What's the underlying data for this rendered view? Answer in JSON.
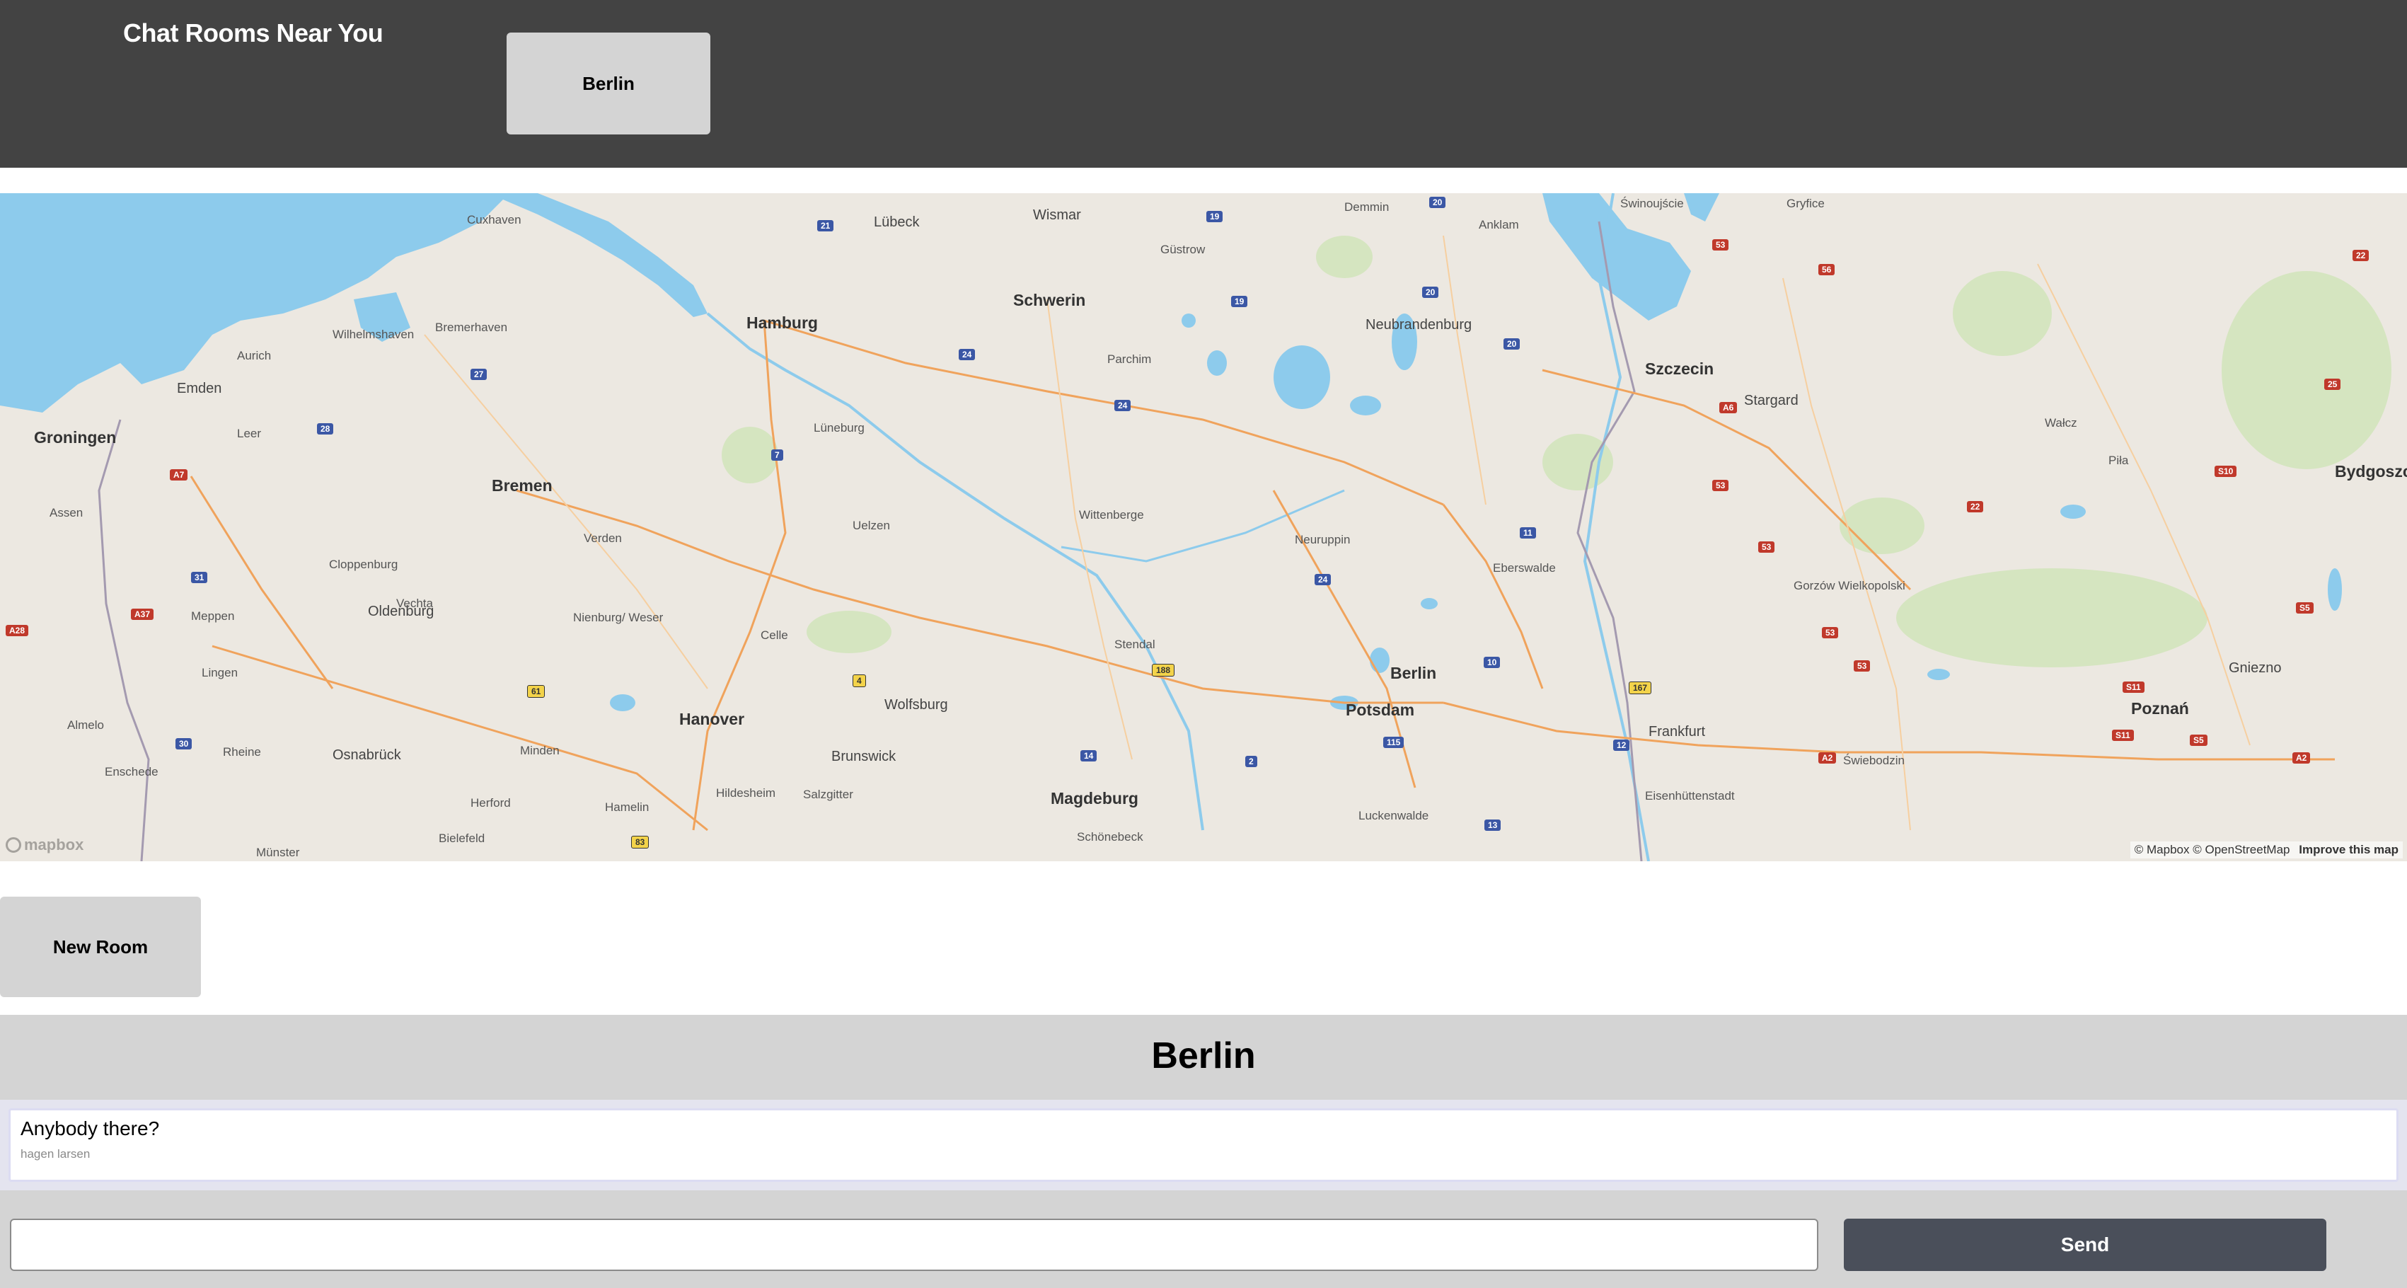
{
  "header": {
    "title": "Chat Rooms Near You",
    "city_button": "Berlin"
  },
  "map": {
    "attribution_mapbox": "© Mapbox",
    "attribution_osm": "© OpenStreetMap",
    "improve_link": "Improve this map",
    "logo_text": "mapbox",
    "markers": [
      {
        "name": "Neubrandenburg"
      },
      {
        "name": "Berlin"
      }
    ],
    "labels": {
      "hamburg": "Hamburg",
      "bremen": "Bremen",
      "hanover": "Hanover",
      "berlin": "Berlin",
      "szczecin": "Szczecin",
      "magdeburg": "Magdeburg",
      "potsdam": "Potsdam",
      "schwerin": "Schwerin",
      "neubrandenburg": "Neubrandenburg",
      "poznan": "Poznań",
      "groningen": "Groningen",
      "oldenburg": "Oldenburg",
      "lubeck": "Lübeck",
      "wismar": "Wismar",
      "rostock_area": "Güstrow",
      "wolfsburg": "Wolfsburg",
      "brunswick": "Brunswick",
      "frankfurt": "Frankfurt",
      "stargard": "Stargard",
      "gniezno": "Gniezno",
      "osnabruck": "Osnabrück",
      "emden": "Emden",
      "bydgoszcz": "Bydgoszcz",
      "cuxhaven": "Cuxhaven",
      "anklam": "Anklam",
      "demmin": "Demmin",
      "swinoujscie": "Świnoujście",
      "gryfice": "Gryfice",
      "celle": "Celle",
      "luneburg": "Lüneburg",
      "uelzen": "Uelzen",
      "stendal": "Stendal",
      "neuruppin": "Neuruppin",
      "eberswalde": "Eberswalde",
      "minden": "Minden",
      "hamelin": "Hamelin",
      "bielefeld": "Bielefeld",
      "hildesheim": "Hildesheim",
      "salzgitter": "Salzgitter",
      "schonebeck": "Schönebeck",
      "luckenwalde": "Luckenwalde",
      "eisenhuttenstadt": "Eisenhüttenstadt",
      "swiebodzin": "Świebodzin",
      "gorzow": "Gorzów Wielkopolski",
      "pila": "Piła",
      "walcz": "Wałcz",
      "parchim": "Parchim",
      "wittenberge": "Wittenberge",
      "leer": "Leer",
      "aurich": "Aurich",
      "wilhelmshaven": "Wilhelmshaven",
      "bremerhaven": "Bremerhaven",
      "verden": "Verden",
      "nienburg": "Nienburg/ Weser",
      "assen": "Assen",
      "lingen": "Lingen",
      "meppen": "Meppen",
      "cloppenburg": "Cloppenburg",
      "vechta": "Vechta",
      "rheine": "Rheine",
      "enschede": "Enschede",
      "almelo": "Almelo",
      "herford": "Herford",
      "munster": "Münster"
    }
  },
  "new_room_button": "New Room",
  "chat": {
    "room_title": "Berlin",
    "messages": [
      {
        "text": "Anybody there?",
        "author": "hagen larsen"
      }
    ],
    "input_value": "",
    "send_label": "Send"
  }
}
